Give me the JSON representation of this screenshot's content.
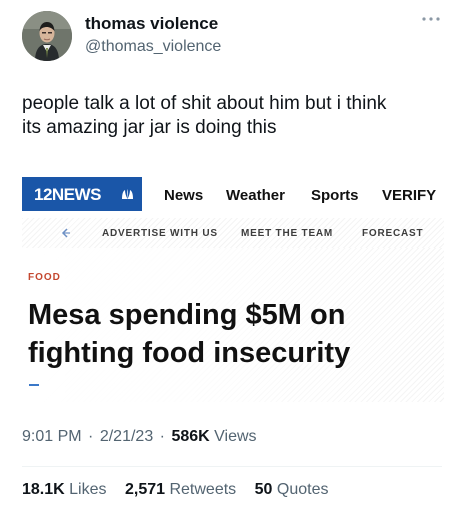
{
  "tweet": {
    "author": {
      "display_name": "thomas violence",
      "handle": "@thomas_violence"
    },
    "text_lines": [
      "people talk a lot of shit about him but i think",
      "its amazing jar jar is doing this"
    ],
    "embedded": {
      "brand": "12NEWS",
      "nav": [
        "News",
        "Weather",
        "Sports",
        "VERIFY"
      ],
      "subnav": [
        "ADVERTISE WITH US",
        "MEET THE TEAM",
        "FORECAST"
      ],
      "category": "FOOD",
      "headline_lines": [
        "Mesa spending $5M on",
        "fighting food insecurity"
      ]
    },
    "meta": {
      "time": "9:01 PM",
      "date": "2/21/23",
      "views_count": "586K",
      "views_label": "Views",
      "separator": "·"
    },
    "stats": {
      "likes_count": "18.1K",
      "likes_label": "Likes",
      "retweets_count": "2,571",
      "retweets_label": "Retweets",
      "quotes_count": "50",
      "quotes_label": "Quotes"
    }
  },
  "colors": {
    "text_primary": "#0f1419",
    "text_secondary": "#536471",
    "news_blue": "#1a56a8",
    "news_category": "#c4472f"
  },
  "icons": {
    "more": "more-options-icon",
    "back": "back-arrow-icon",
    "peacock": "peacock-logo-icon"
  }
}
